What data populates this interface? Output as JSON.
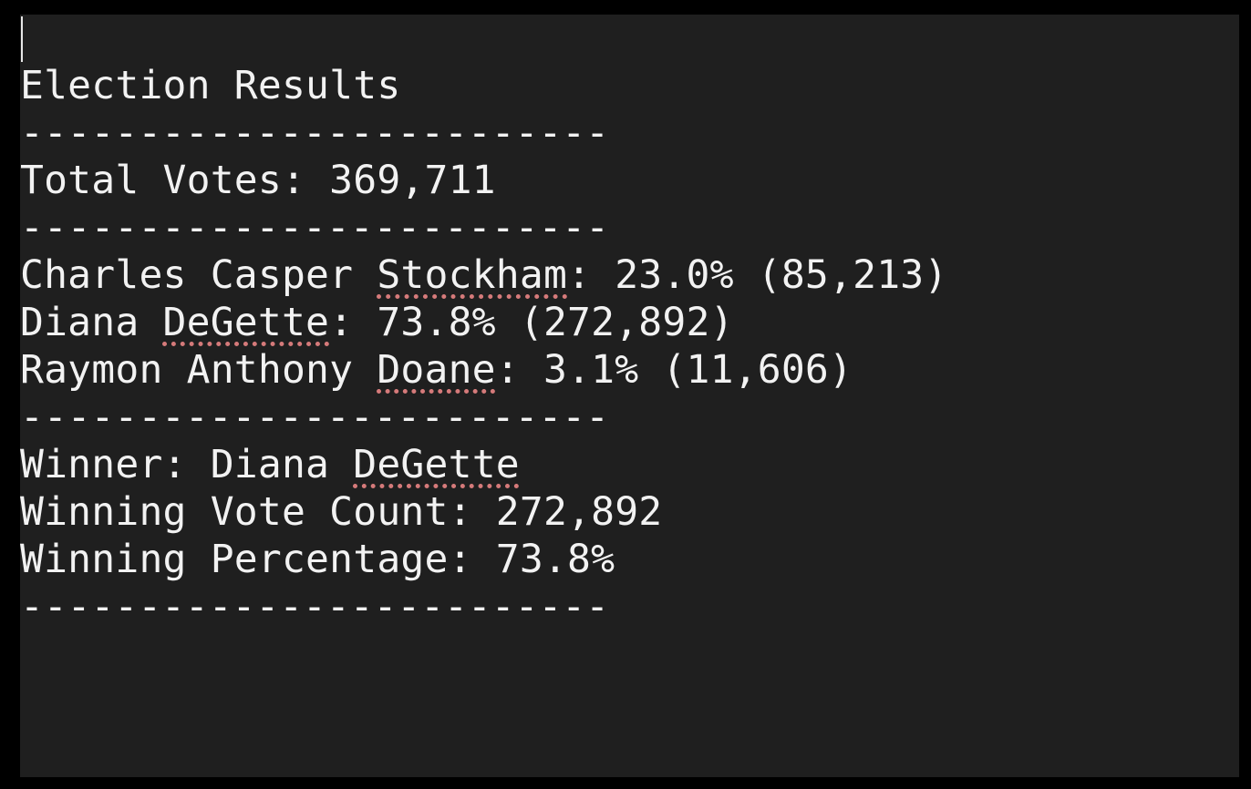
{
  "title": "Election Results",
  "separator": "-------------------------",
  "total_votes_line": "Total Votes: 369,711",
  "candidates": [
    {
      "prefix": "Charles Casper ",
      "flagged": "Stockham",
      "suffix": ": 23.0% (85,213)"
    },
    {
      "prefix": "Diana ",
      "flagged": "DeGette",
      "suffix": ": 73.8% (272,892)"
    },
    {
      "prefix": "Raymon Anthony ",
      "flagged": "Doane",
      "suffix": ": 3.1% (11,606)"
    }
  ],
  "winner": {
    "prefix": "Winner: Diana ",
    "flagged": "DeGette"
  },
  "winning_vote_count_line": "Winning Vote Count: 272,892",
  "winning_percentage_line": "Winning Percentage: 73.8%",
  "colors": {
    "background": "#1f1f1f",
    "text": "#f2f2f2",
    "spellcheck_underline": "#d57a7a"
  }
}
